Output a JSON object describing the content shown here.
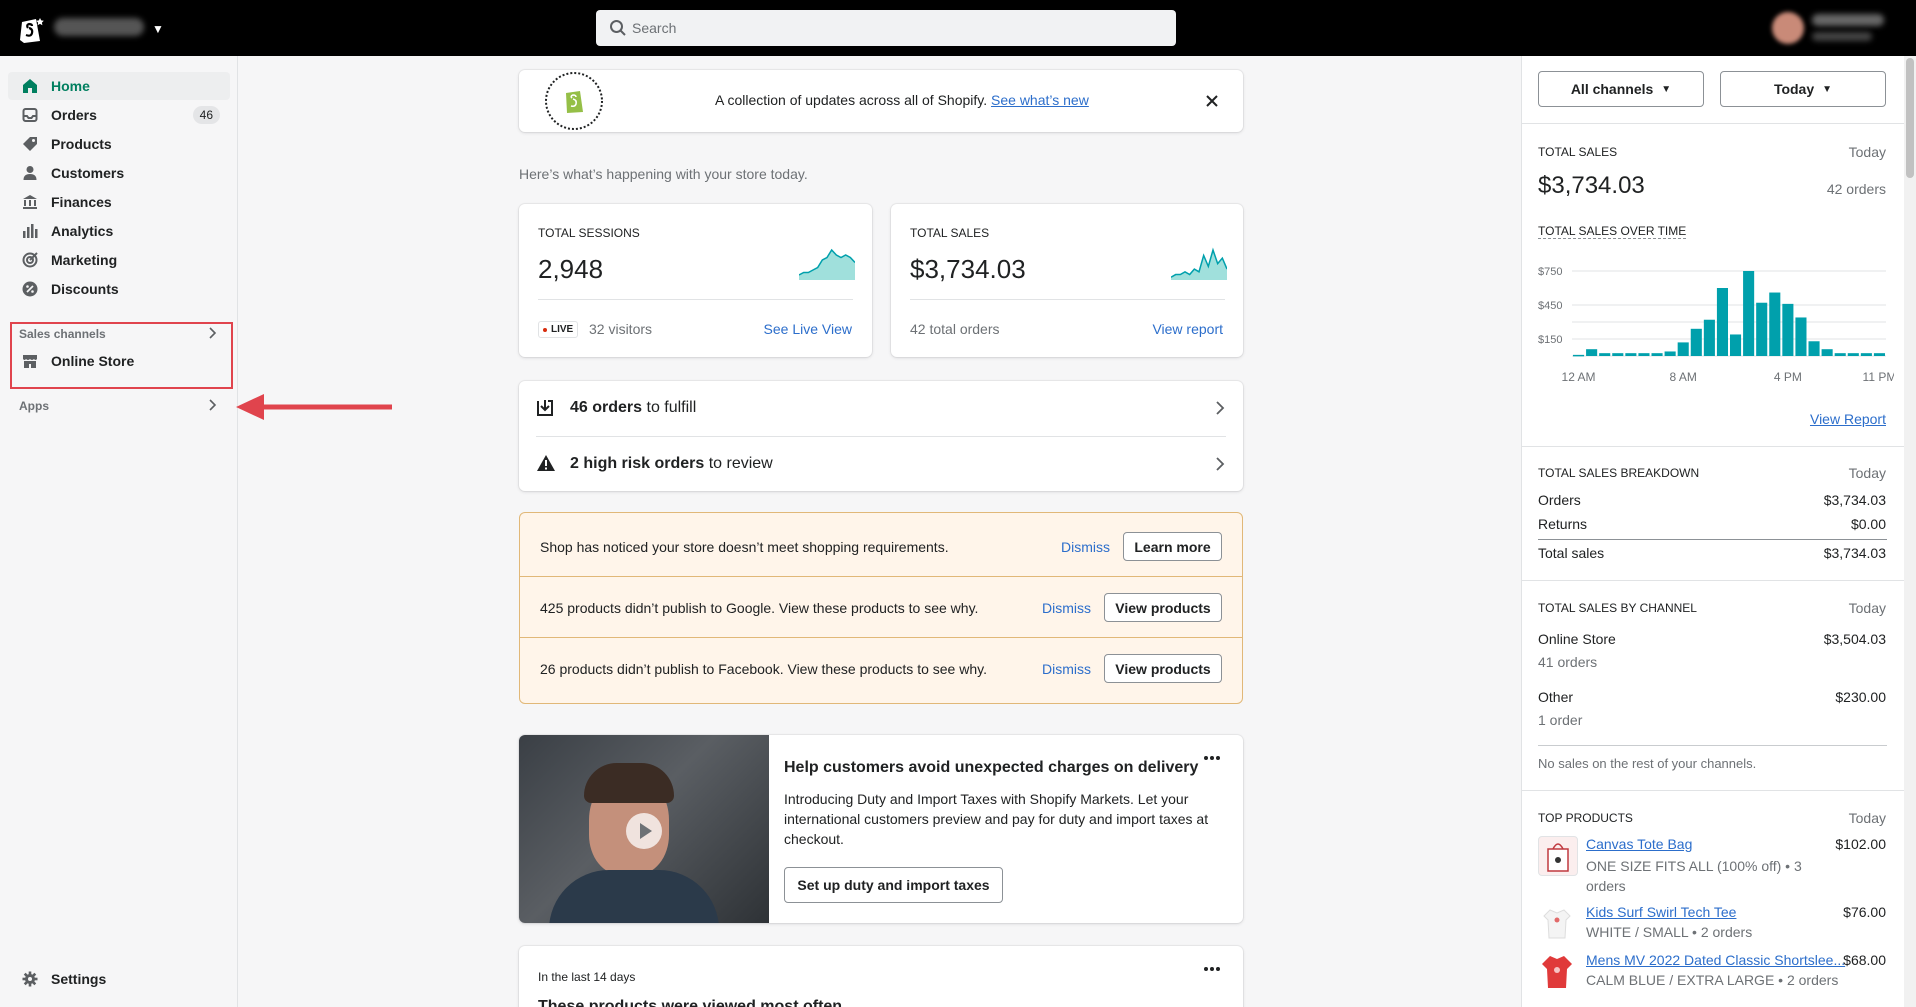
{
  "topbar": {
    "search_placeholder": "Search"
  },
  "sidebar": {
    "items": [
      {
        "label": "Home",
        "icon": "home-icon"
      },
      {
        "label": "Orders",
        "icon": "orders-icon",
        "badge": "46"
      },
      {
        "label": "Products",
        "icon": "tag-icon"
      },
      {
        "label": "Customers",
        "icon": "person-icon"
      },
      {
        "label": "Finances",
        "icon": "bank-icon"
      },
      {
        "label": "Analytics",
        "icon": "bar-chart-icon"
      },
      {
        "label": "Marketing",
        "icon": "target-icon"
      },
      {
        "label": "Discounts",
        "icon": "discount-icon"
      }
    ],
    "sales_channels_label": "Sales channels",
    "online_store": "Online Store",
    "apps_label": "Apps",
    "settings": "Settings"
  },
  "banner": {
    "text": "A collection of updates across all of Shopify.",
    "link": "See what’s new",
    "badge_text": "SHOPIFY EDITIONS"
  },
  "intro": "Here’s what’s happening with your store today.",
  "sessions": {
    "label": "TOTAL SESSIONS",
    "value": "2,948",
    "live": "LIVE",
    "visitors": "32 visitors",
    "link": "See Live View"
  },
  "sales_card": {
    "label": "TOTAL SALES",
    "value": "$3,734.03",
    "orders": "42 total orders",
    "link": "View report"
  },
  "tasks": {
    "fulfill_bold": "46 orders",
    "fulfill_rest": " to fulfill",
    "risk_bold": "2 high risk orders",
    "risk_rest": " to review"
  },
  "alerts": [
    {
      "text": "Shop has noticed your store doesn’t meet shopping requirements.",
      "dismiss": "Dismiss",
      "button": "Learn more"
    },
    {
      "text": "425 products didn’t publish to Google. View these products to see why.",
      "dismiss": "Dismiss",
      "button": "View products"
    },
    {
      "text": "26 products didn’t publish to Facebook. View these products to see why.",
      "dismiss": "Dismiss",
      "button": "View products"
    }
  ],
  "promo": {
    "title": "Help customers avoid unexpected charges on delivery",
    "body": "Introducing Duty and Import Taxes with Shopify Markets. Let your international customers preview and pay for duty and import taxes at checkout.",
    "button": "Set up duty and import taxes"
  },
  "viewed": {
    "caption": "In the last 14 days",
    "title": "These products were viewed most often"
  },
  "rail": {
    "channels_dd": "All channels",
    "date_dd": "Today",
    "total_sales": {
      "label": "TOTAL SALES",
      "period": "Today",
      "value": "$3,734.03",
      "orders": "42 orders"
    },
    "over_time_label": "TOTAL SALES OVER TIME",
    "view_report": "View Report",
    "breakdown": {
      "label": "TOTAL SALES BREAKDOWN",
      "period": "Today",
      "rows": [
        {
          "name": "Orders",
          "value": "$3,734.03"
        },
        {
          "name": "Returns",
          "value": "$0.00"
        },
        {
          "name": "Total sales",
          "value": "$3,734.03"
        }
      ]
    },
    "by_channel": {
      "label": "TOTAL SALES BY CHANNEL",
      "period": "Today",
      "rows": [
        {
          "name": "Online Store",
          "value": "$3,504.03",
          "sub": "41 orders"
        },
        {
          "name": "Other",
          "value": "$230.00",
          "sub": "1 order"
        }
      ],
      "note": "No sales on the rest of your channels."
    },
    "top_products": {
      "label": "TOP PRODUCTS",
      "period": "Today",
      "items": [
        {
          "name": "Canvas Tote Bag",
          "price": "$102.00",
          "variant": "ONE SIZE FITS ALL (100% off) • 3 orders"
        },
        {
          "name": "Kids Surf Swirl Tech Tee",
          "price": "$76.00",
          "variant": "WHITE / SMALL • 2 orders"
        },
        {
          "name": "Mens MV 2022 Dated Classic Shortslee...",
          "price": "$68.00",
          "variant": "CALM BLUE / EXTRA LARGE • 2 orders"
        }
      ]
    }
  },
  "chart_data": {
    "type": "bar",
    "title": "TOTAL SALES OVER TIME",
    "ylabels": [
      "$750",
      "$450",
      "$150"
    ],
    "xlabels": [
      "12 AM",
      "8 AM",
      "4 PM",
      "11 PM"
    ],
    "ylim": [
      0,
      900
    ],
    "categories": [
      "12 AM",
      "1 AM",
      "2 AM",
      "3 AM",
      "4 AM",
      "5 AM",
      "6 AM",
      "7 AM",
      "8 AM",
      "9 AM",
      "10 AM",
      "11 AM",
      "12 PM",
      "1 PM",
      "2 PM",
      "3 PM",
      "4 PM",
      "5 PM",
      "6 PM",
      "7 PM",
      "8 PM",
      "9 PM",
      "10 PM",
      "11 PM"
    ],
    "values": [
      10,
      60,
      25,
      25,
      25,
      25,
      25,
      40,
      120,
      240,
      320,
      600,
      190,
      750,
      470,
      560,
      460,
      340,
      130,
      60,
      25,
      25,
      25,
      25
    ],
    "color": "#00a0ac",
    "grid": true
  },
  "spark_sessions": [
    2,
    3,
    3,
    4,
    5,
    8,
    9,
    12,
    10,
    9,
    10,
    9,
    7
  ],
  "spark_sales": [
    1,
    2,
    2,
    3,
    2,
    4,
    3,
    9,
    5,
    11,
    6,
    8,
    4
  ]
}
